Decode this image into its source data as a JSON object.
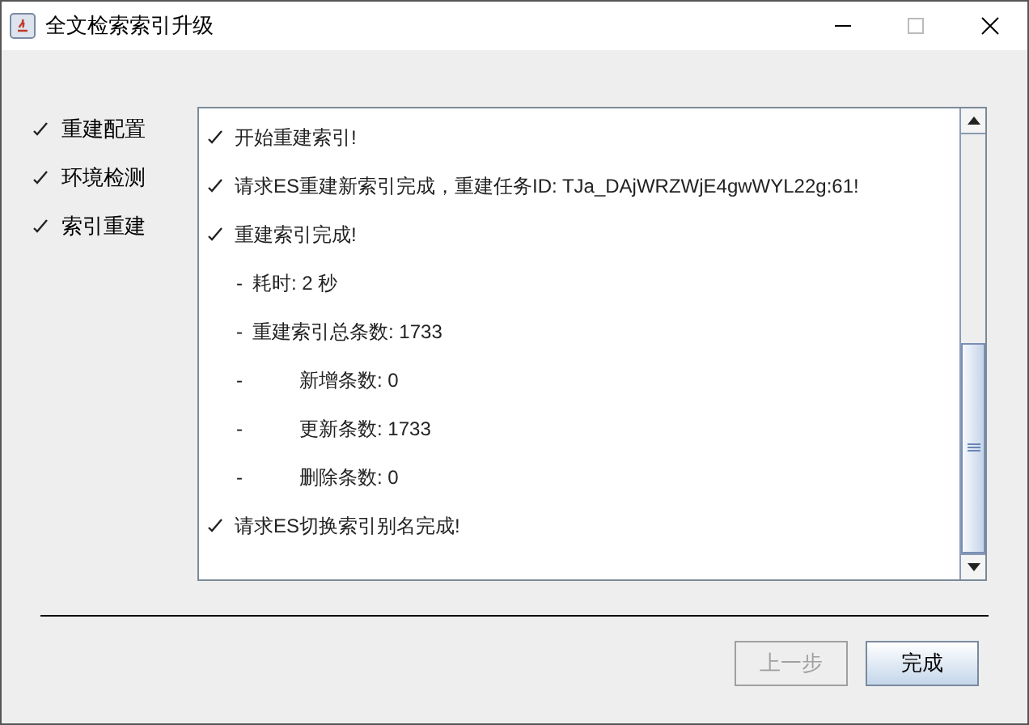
{
  "window": {
    "title": "全文检索索引升级"
  },
  "steps": [
    {
      "label": "重建配置",
      "checked": true
    },
    {
      "label": "环境检测",
      "checked": true
    },
    {
      "label": "索引重建",
      "checked": true
    }
  ],
  "log": [
    {
      "kind": "check",
      "text": "开始重建索引!"
    },
    {
      "kind": "check",
      "text": "请求ES重建新索引完成，重建任务ID: TJa_DAjWRZWjE4gwWYL22g:61!"
    },
    {
      "kind": "check",
      "text": "重建索引完成!"
    },
    {
      "kind": "dash",
      "marker": "-",
      "text": "耗时: 2 秒"
    },
    {
      "kind": "dash",
      "marker": "-",
      "text": "重建索引总条数: 1733"
    },
    {
      "kind": "subdash",
      "marker": "-",
      "text": "新增条数: 0"
    },
    {
      "kind": "subdash",
      "marker": "-",
      "text": "更新条数: 1733"
    },
    {
      "kind": "subdash",
      "marker": "-",
      "text": "删除条数: 0"
    },
    {
      "kind": "check",
      "text": "请求ES切换索引别名完成!"
    }
  ],
  "buttons": [
    {
      "label": "上一步",
      "disabled": true
    },
    {
      "label": "完成",
      "disabled": false
    }
  ]
}
